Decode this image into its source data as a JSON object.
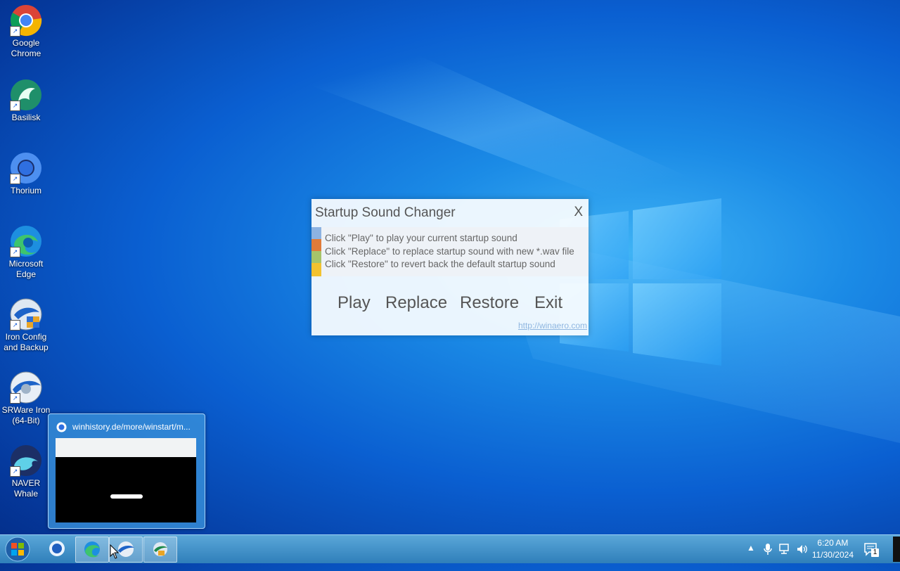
{
  "desktop_icons": [
    {
      "label": "Google Chrome",
      "icon": "chrome-icon"
    },
    {
      "label": "Basilisk",
      "icon": "basilisk-icon"
    },
    {
      "label": "Thorium",
      "icon": "thorium-icon"
    },
    {
      "label": "Microsoft Edge",
      "icon": "edge-icon"
    },
    {
      "label": "Iron Config and Backup",
      "icon": "iron-config-icon"
    },
    {
      "label": "SRWare Iron (64-Bit)",
      "icon": "srware-iron-icon"
    },
    {
      "label": "NAVER Whale",
      "icon": "naver-whale-icon"
    }
  ],
  "dialog": {
    "title": "Startup Sound Changer",
    "close": "X",
    "info": [
      {
        "text": "Click \"Play\" to play your current startup sound",
        "color": "#8db3e2"
      },
      {
        "text": "Click \"Replace\" to replace startup sound with new *.wav file",
        "color": "#e07b39"
      },
      {
        "text": "Click \"Restore\" to revert back the default startup sound",
        "color": "#a6c46a"
      }
    ],
    "strip_extra_color": "#f2c230",
    "buttons": {
      "play": "Play",
      "replace": "Replace",
      "restore": "Restore",
      "exit": "Exit"
    },
    "link": "http://winaero.com"
  },
  "thumbnail": {
    "title": "winhistory.de/more/winstart/m..."
  },
  "taskbar": {
    "items": [
      "thorium-icon",
      "edge-icon",
      "srware-iron-icon",
      "iron-config-icon"
    ],
    "time": "6:20 AM",
    "date": "11/30/2024",
    "notifications": "1"
  }
}
